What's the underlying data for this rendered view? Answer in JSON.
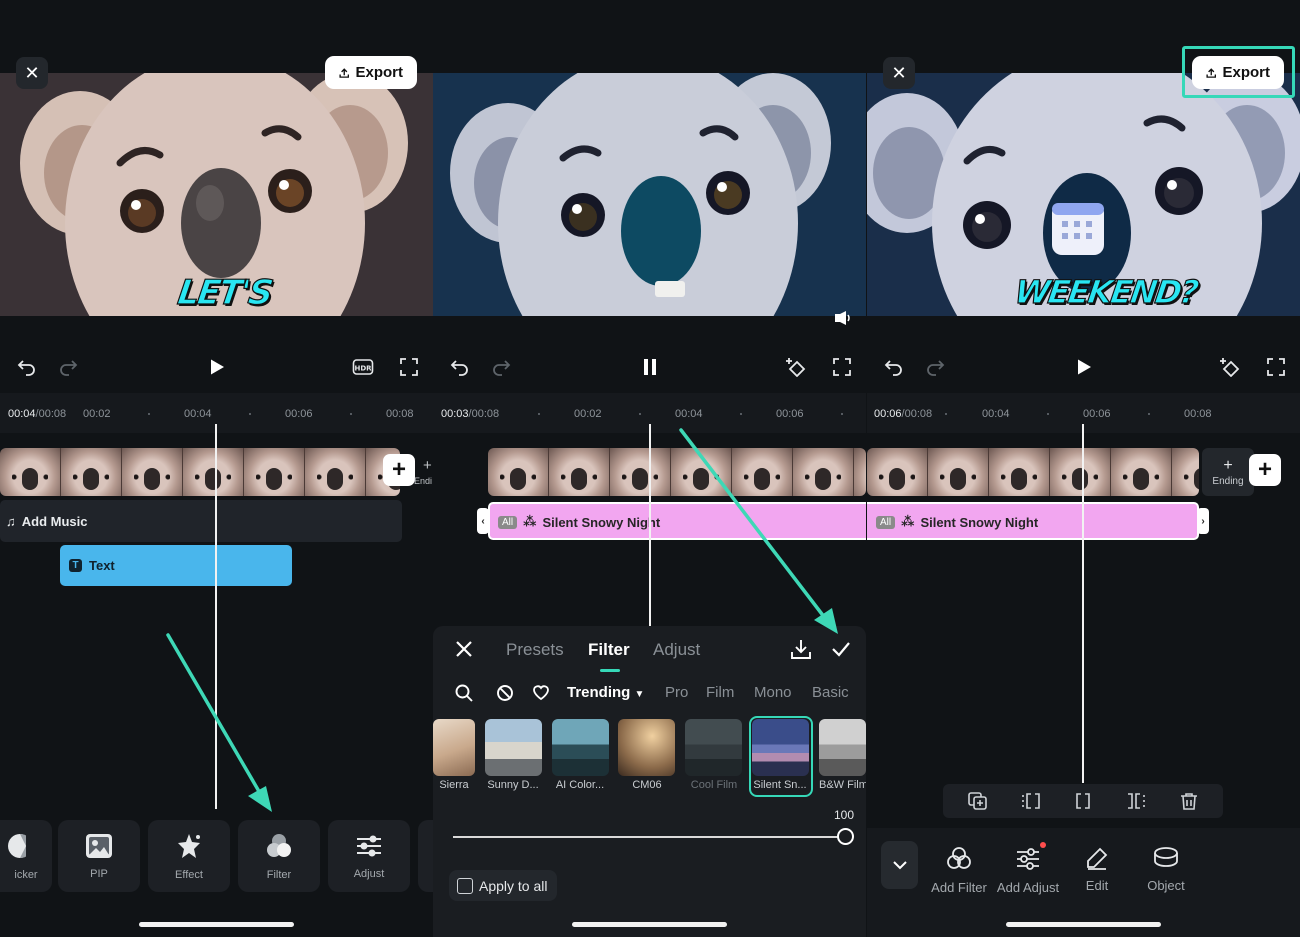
{
  "colors": {
    "accent": "#36d8b8",
    "caption": "#29e6f2",
    "filter_track": "#f2a6f0",
    "text_track": "#49b6ec"
  },
  "panel1": {
    "export_label": "Export",
    "caption": "LET'S",
    "time_current": "00:04",
    "time_total": "/00:08",
    "ruler_ticks": [
      "00:02",
      "00:04",
      "00:06",
      "00:08"
    ],
    "music_label": "Add Music",
    "text_track_label": "Text",
    "ending_partial": "Endi",
    "tools": [
      "icker",
      "PIP",
      "Effect",
      "Filter",
      "Adjust"
    ],
    "icons": [
      "close-icon",
      "upload-icon",
      "undo-icon",
      "redo-icon",
      "play-icon",
      "hdr-icon",
      "fullscreen-icon"
    ]
  },
  "panel2": {
    "time_current": "00:03",
    "time_total": "/00:08",
    "ruler_ticks": [
      "00:02",
      "00:04",
      "00:06"
    ],
    "filter_name": "Silent Snowy Night",
    "all_chip": "All",
    "tabs": [
      "Presets",
      "Filter",
      "Adjust"
    ],
    "active_tab": "Filter",
    "categories": [
      "Trending",
      "Pro",
      "Film",
      "Mono",
      "Basic"
    ],
    "active_category": "Trending",
    "filters": [
      {
        "label": "Sierra"
      },
      {
        "label": "Sunny D..."
      },
      {
        "label": "AI Color..."
      },
      {
        "label": "CM06"
      },
      {
        "label": "Cool Film"
      },
      {
        "label": "Silent Sn..."
      },
      {
        "label": "B&W Film"
      }
    ],
    "selected_filter": "Silent Sn...",
    "intensity_value": "100",
    "intensity_fraction": 1.0,
    "apply_all_label": "Apply to all"
  },
  "panel3": {
    "export_label": "Export",
    "caption": "WEEKEND?",
    "time_current": "00:06",
    "time_total": "/00:08",
    "ruler_ticks": [
      "00:04",
      "00:06",
      "00:08"
    ],
    "ending_label": "Ending",
    "filter_name": "Silent Snowy Night",
    "all_chip": "All",
    "tools": [
      "Add Filter",
      "Add Adjust",
      "Edit",
      "Object"
    ]
  }
}
